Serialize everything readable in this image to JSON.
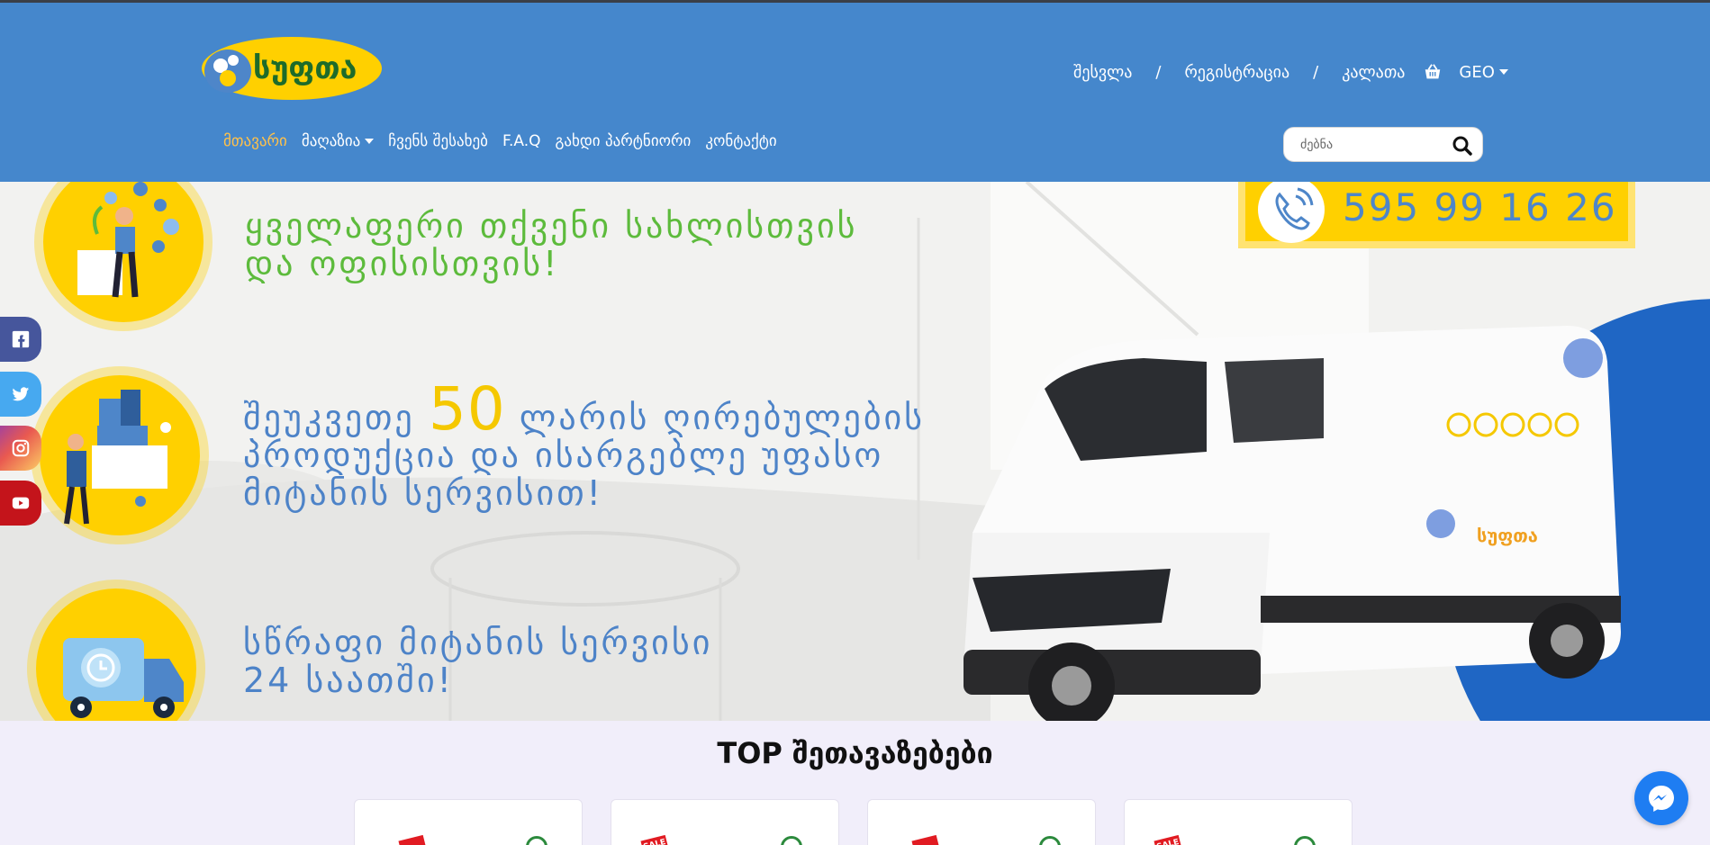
{
  "brand": {
    "logo_text": "სუფთა"
  },
  "topnav": {
    "login": "შესვლა",
    "separator": "/",
    "register": "რეგისტრაცია",
    "cart": "კალათა",
    "language": "GEO"
  },
  "mainnav": {
    "items": [
      {
        "label": "მთავარი",
        "active": true
      },
      {
        "label": "მაღაზია",
        "dropdown": true
      },
      {
        "label": "ჩვენს შესახებ"
      },
      {
        "label": "F.A.Q"
      },
      {
        "label": "გახდი პარტნიორი"
      },
      {
        "label": "კონტაქტი"
      }
    ]
  },
  "search": {
    "placeholder": "ძებნა"
  },
  "hero": {
    "slogan1": [
      "ყველაფერი თქვენი სახლისთვის",
      "და ოფისისთვის!"
    ],
    "slogan2_prefix": "შეუკვეთე",
    "slogan2_number": "50",
    "slogan2_suffix": "ლარის ღირებულების",
    "slogan2_lines": [
      "პროდუქცია და ისარგებლე უფასო",
      "მიტანის სერვისით!"
    ],
    "slogan3": [
      "სწრაფი მიტანის სერვისი",
      "24 საათში!"
    ],
    "phone": "595 99 16 26",
    "van_logo_text": "სუფთა"
  },
  "social": [
    "facebook-icon",
    "twitter-icon",
    "instagram-icon",
    "youtube-icon"
  ],
  "section": {
    "title": "TOP შეთავაზებები"
  },
  "cards": [
    {
      "badge": ""
    },
    {
      "badge": "SALE"
    },
    {
      "badge": ""
    },
    {
      "badge": "SALE"
    }
  ],
  "colors": {
    "header": "#4587cc",
    "accent_orange": "#ffc14a",
    "yellow": "#ffd000",
    "green_text": "#5dbb3c",
    "blue_text": "#4d83c8",
    "arc_blue": "#1f66c4",
    "messenger": "#1e7df2"
  }
}
